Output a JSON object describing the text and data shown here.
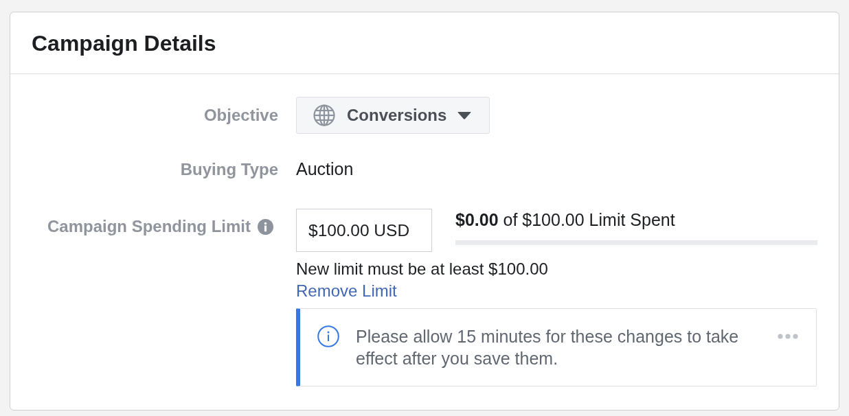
{
  "panel": {
    "title": "Campaign Details"
  },
  "fields": [
    {
      "kind": "dropdown",
      "label": "Objective",
      "value": "Conversions"
    },
    {
      "kind": "text",
      "label": "Buying Type",
      "value": "Auction"
    },
    {
      "kind": "limit",
      "label": "Campaign Spending Limit",
      "input_value": "$100.00 USD",
      "spent": "**$0.00** of $100.00 Limit Spent",
      "level": 0,
      "hint": "New limit must be at least $100.00",
      "link": "Remove Limit"
    }
  ],
  "notice": {
    "text": "Please allow 15 minutes for these changes to take effect after you save them."
  }
}
